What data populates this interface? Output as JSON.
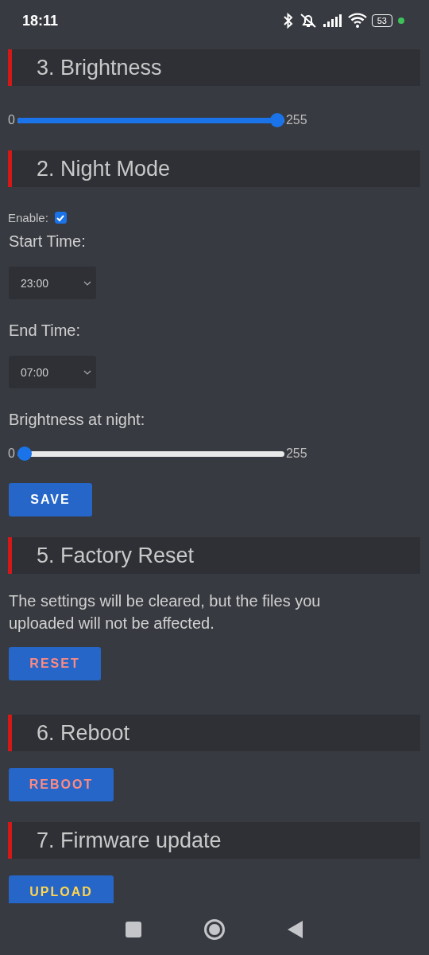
{
  "status_bar": {
    "time": "18:11",
    "battery": "53"
  },
  "brightness": {
    "title": "3. Brightness",
    "slider": {
      "min": "0",
      "max": "255",
      "level": 1
    }
  },
  "night_mode": {
    "title": "2. Night Mode",
    "enable_label": "Enable:",
    "enabled": true,
    "start_label": "Start Time:",
    "start_value": "23:00",
    "end_label": "End Time:",
    "end_value": "07:00",
    "night_label": "Brightness at night:",
    "night_slider": {
      "min": "0",
      "max": "255",
      "level": 0
    },
    "save_button": {
      "label": "SAVE",
      "kind": "primary"
    }
  },
  "factory_reset": {
    "title": "5. Factory Reset",
    "text": "The settings will be cleared, but the files you uploaded will not be affected.",
    "button": {
      "label": "RESET",
      "kind": "danger"
    }
  },
  "reboot": {
    "title": "6. Reboot",
    "button": {
      "label": "REBOOT",
      "kind": "danger"
    }
  },
  "firmware": {
    "title": "7. Firmware update",
    "button": {
      "label": "UPLOAD",
      "kind": "warning"
    }
  }
}
